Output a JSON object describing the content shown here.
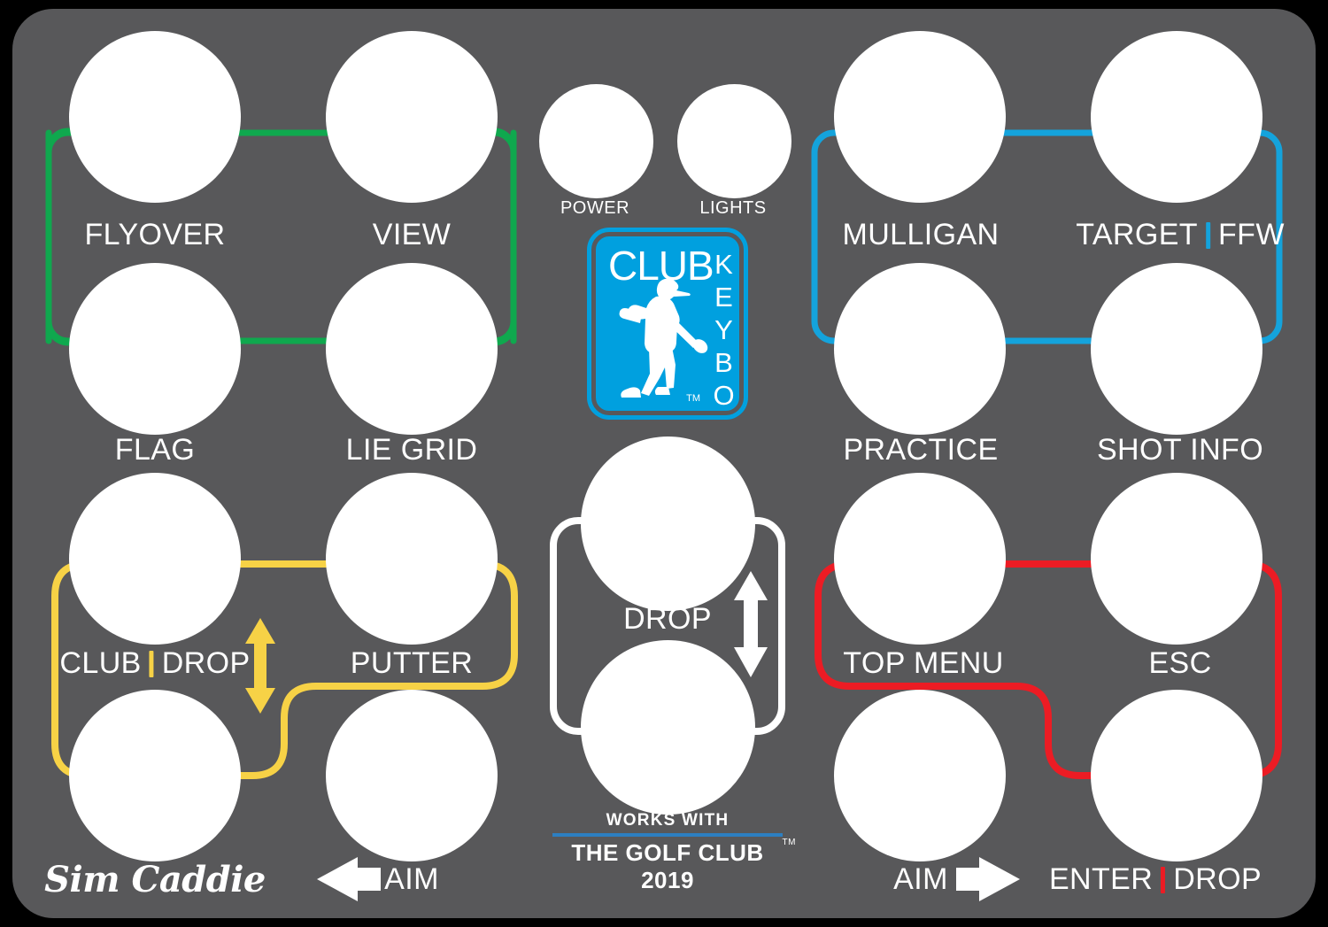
{
  "device": {
    "brand": "Sim Caddie",
    "logo": {
      "word_top": "CLUB",
      "word_side": "KEYBOARD",
      "trademark": "TM",
      "icon": "golfer-silhouette-icon",
      "color": "#00A0DF"
    },
    "compat": {
      "line1": "WORKS WITH",
      "line2": "THE GOLF CLUB 2019",
      "trademark": "TM",
      "rule_color": "#2D7FC1"
    },
    "plate_color": "#58585A",
    "key_color": "#FFFFFF"
  },
  "groups": {
    "green": {
      "color": "#0FA84E",
      "name": "camera-group"
    },
    "blue": {
      "color": "#14A3DC",
      "name": "shot-tools-group"
    },
    "yellow": {
      "color": "#F7D246",
      "name": "club-group"
    },
    "red": {
      "color": "#EC1C24",
      "name": "menu-group"
    },
    "white": {
      "color": "#FFFFFF",
      "name": "drop-group"
    }
  },
  "keys": {
    "flyover": {
      "label": "FLYOVER",
      "group": "green"
    },
    "view": {
      "label": "VIEW",
      "group": "green"
    },
    "flag": {
      "label": "FLAG",
      "group": "green"
    },
    "lie_grid": {
      "label": "LIE GRID",
      "group": "green"
    },
    "power": {
      "label": "POWER",
      "group": "none"
    },
    "lights": {
      "label": "LIGHTS",
      "group": "none"
    },
    "mulligan": {
      "label": "MULLIGAN",
      "group": "blue"
    },
    "target_ffw": {
      "label_a": "TARGET",
      "label_b": "FFW",
      "sep_color": "#14A3DC",
      "group": "blue"
    },
    "practice": {
      "label": "PRACTICE",
      "group": "blue"
    },
    "shot_info": {
      "label": "SHOT INFO",
      "group": "blue"
    },
    "club_drop": {
      "label_a": "CLUB",
      "label_b": "DROP",
      "sep_color": "#F7D246",
      "group": "yellow"
    },
    "putter": {
      "label": "PUTTER",
      "group": "yellow"
    },
    "aim_left": {
      "label": "AIM",
      "icon": "arrow-left-icon",
      "group": "none"
    },
    "drop_up": {
      "label": "",
      "group": "white"
    },
    "drop": {
      "label": "DROP",
      "icon": "arrow-up-down-icon",
      "group": "white"
    },
    "drop_down": {
      "label": "",
      "group": "white"
    },
    "top_menu": {
      "label": "TOP MENU",
      "group": "red"
    },
    "esc": {
      "label": "ESC",
      "group": "red"
    },
    "aim_right": {
      "label": "AIM",
      "icon": "arrow-right-icon",
      "group": "none"
    },
    "enter_drop": {
      "label_a": "ENTER",
      "label_b": "DROP",
      "sep_color": "#EC1C24",
      "group": "red"
    }
  },
  "indicators": {
    "club_drop_arrow": {
      "icon": "arrow-up-down-icon",
      "color": "#F7D246"
    },
    "drop_arrow": {
      "icon": "arrow-up-down-icon",
      "color": "#FFFFFF"
    }
  }
}
